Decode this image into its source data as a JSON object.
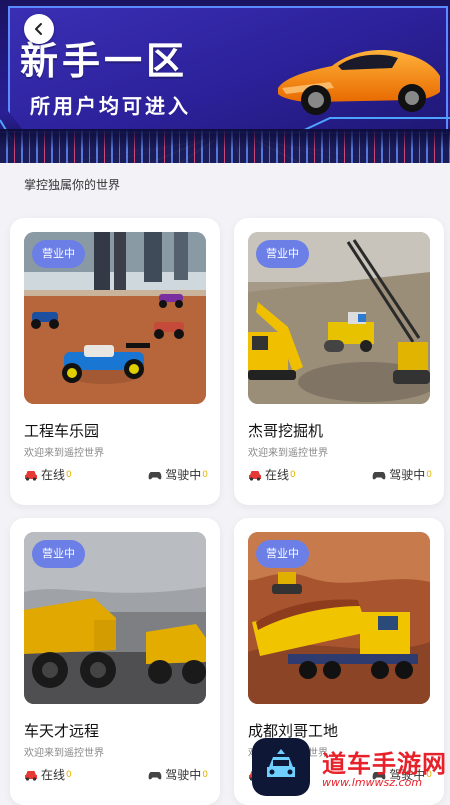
{
  "banner": {
    "title": "新手一区",
    "subtitle": "所用户均可进入"
  },
  "section": {
    "subtitle": "掌控独属你的世界"
  },
  "cards": [
    {
      "badge": "营业中",
      "name": "工程车乐园",
      "desc": "欢迎来到遥控世界",
      "online_label": "在线",
      "online_count": "0",
      "driving_label": "驾驶中",
      "driving_count": "0",
      "online_icon": "car-icon",
      "driving_icon": "gamepad-icon"
    },
    {
      "badge": "营业中",
      "name": "杰哥挖掘机",
      "desc": "欢迎来到遥控世界",
      "online_label": "在线",
      "online_count": "0",
      "driving_label": "驾驶中",
      "driving_count": "0",
      "online_icon": "car-icon",
      "driving_icon": "gamepad-icon"
    },
    {
      "badge": "营业中",
      "name": "车天才远程",
      "desc": "欢迎来到遥控世界",
      "online_label": "在线",
      "online_count": "0",
      "driving_label": "驾驶中",
      "driving_count": "0",
      "online_icon": "car-icon",
      "driving_icon": "gamepad-icon"
    },
    {
      "badge": "营业中",
      "name": "成都刘哥工地",
      "desc": "欢迎来到遥控世界",
      "online_label": "在线",
      "online_count": "0",
      "driving_label": "驾驶中",
      "driving_count": "0",
      "online_icon": "car-icon",
      "driving_icon": "gamepad-icon"
    }
  ],
  "watermark": {
    "text": "道车手游网",
    "url": "www.lmwwsz.com"
  },
  "colors": {
    "badge": "#6b7fe6",
    "count": "#e6b400",
    "banner": "#2a1f94",
    "watermark": "#e8202a"
  }
}
